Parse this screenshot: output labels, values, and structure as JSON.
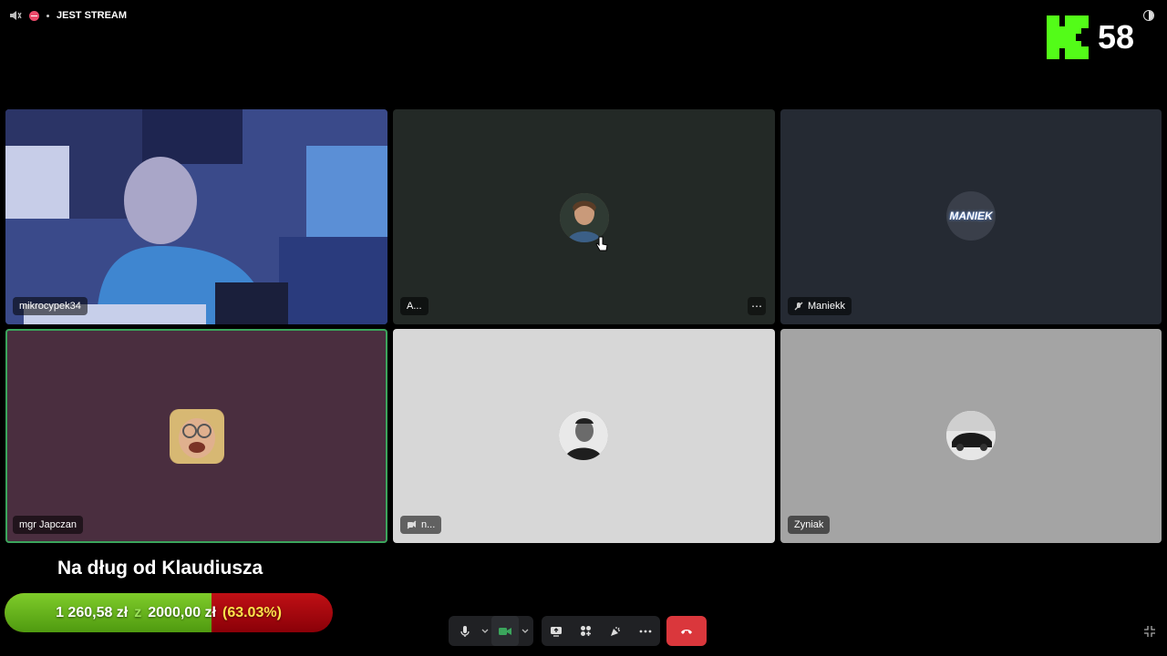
{
  "stream": {
    "title": "JEST STREAM"
  },
  "viewers": {
    "count": "58"
  },
  "tiles": [
    {
      "name": "mikrocypek34"
    },
    {
      "name": "A..."
    },
    {
      "name": "Maniekk"
    },
    {
      "name": "mgr Japczan"
    },
    {
      "name": "n..."
    },
    {
      "name": "Zyniak"
    }
  ],
  "fundraiser": {
    "title": "Na dług od Klaudiusza",
    "current": "1 260,58 zł",
    "connector": "z",
    "goal": "2000,00 zł",
    "percent_text": "(63.03%)",
    "progress": 0.6303
  },
  "avatar_labels": {
    "maniek": "MANIEK"
  },
  "colors": {
    "kick_green": "#53fc18",
    "hangup_red": "#da373c",
    "speaking_border": "#3ba55c"
  }
}
